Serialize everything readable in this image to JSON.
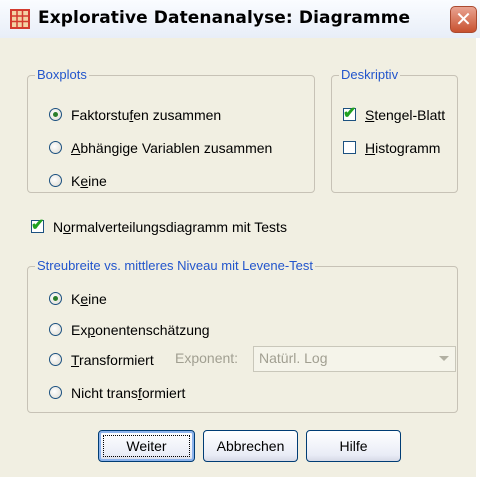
{
  "window": {
    "title": "Explorative Datenanalyse: Diagramme",
    "close_glyph": "✕"
  },
  "boxplots": {
    "legend": "Boxplots",
    "options": [
      {
        "label": "Faktorstufen zusammen",
        "checked": true
      },
      {
        "label": "Abhängige Variablen zusammen",
        "checked": false
      },
      {
        "label": "Keine",
        "checked": false
      }
    ]
  },
  "deskriptiv": {
    "legend": "Deskriptiv",
    "options": [
      {
        "label": "Stengel-Blatt",
        "checked": true
      },
      {
        "label": "Histogramm",
        "checked": false
      }
    ]
  },
  "normal": {
    "label": "Normalverteilungsdiagramm mit Tests",
    "checked": true
  },
  "spread": {
    "legend": "Streubreite vs. mittleres Niveau mit Levene-Test",
    "options": [
      {
        "label": "Keine",
        "checked": true
      },
      {
        "label": "Exponentenschätzung",
        "checked": false
      },
      {
        "label": "Transformiert",
        "checked": false
      },
      {
        "label": "Nicht transformiert",
        "checked": false
      }
    ],
    "exponent_label": "Exponent:",
    "exponent_value": "Natürl. Log"
  },
  "buttons": {
    "continue": "Weiter",
    "cancel": "Abbrechen",
    "help": "Hilfe"
  },
  "colors": {
    "accent": "#2255cc",
    "check": "#21a121",
    "radio_dot": "#2a7d2a"
  }
}
